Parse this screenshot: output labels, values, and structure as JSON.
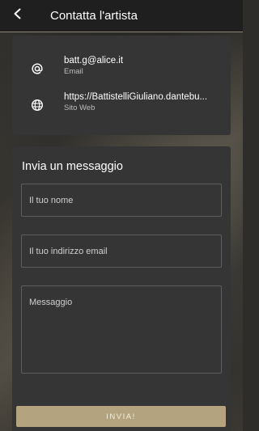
{
  "header": {
    "title": "Contatta l'artista",
    "back_icon": "arrow-left-icon"
  },
  "contacts": [
    {
      "icon": "at-sign-icon",
      "value": "batt.g@alice.it",
      "label": "Email"
    },
    {
      "icon": "globe-icon",
      "value": "https://BattistelliGiuliano.dantebu...",
      "label": "Sito Web"
    }
  ],
  "message_form": {
    "title": "Invia un messaggio",
    "name_placeholder": "Il tuo nome",
    "email_placeholder": "Il tuo indirizzo email",
    "message_placeholder": "Messaggio",
    "send_label": "INVIA!"
  },
  "colors": {
    "topbar": "#1f1f1f",
    "card": "#353535",
    "accent_button": "#b3a47f"
  }
}
